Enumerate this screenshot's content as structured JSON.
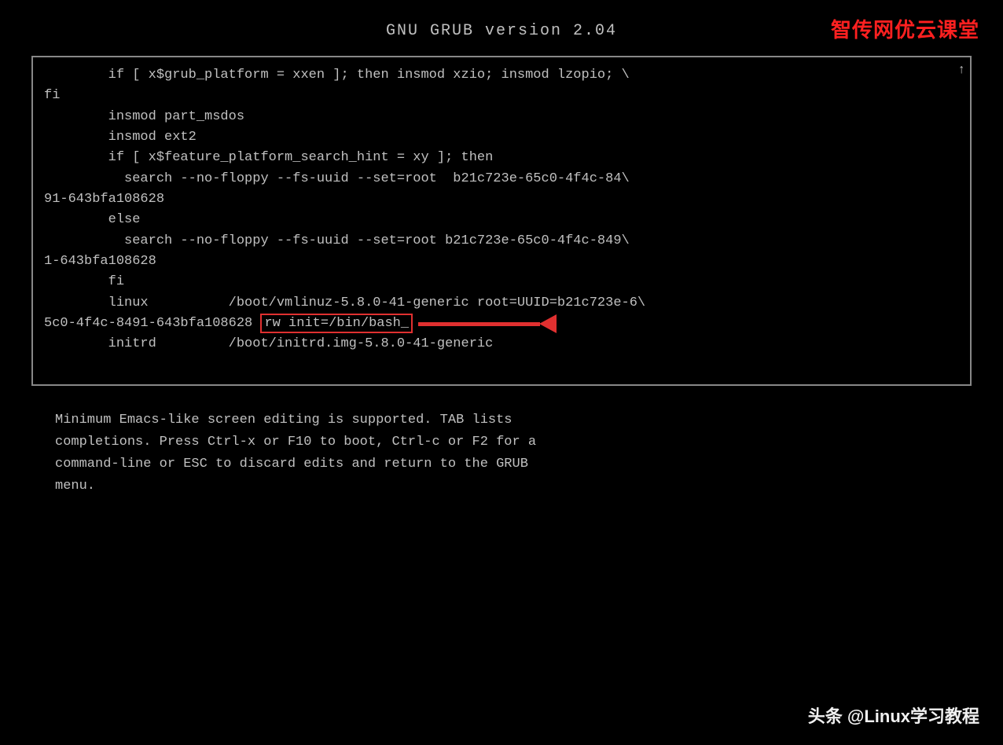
{
  "header": {
    "title": "GNU GRUB  version 2.04"
  },
  "watermark_top": "智传网优云课堂",
  "terminal": {
    "lines": [
      "        if [ x$grub_platform = xxen ]; then insmod xzio; insmod lzopio; \\",
      "fi",
      "        insmod part_msdos",
      "        insmod ext2",
      "        if [ x$feature_platform_search_hint = xy ]; then",
      "          search --no-floppy --fs-uuid --set=root  b21c723e-65c0-4f4c-84\\",
      "91-643bfa108628",
      "        else",
      "          search --no-floppy --fs-uuid --set=root b21c723e-65c0-4f4c-849\\",
      "1-643bfa108628",
      "        fi",
      "        linux          /boot/vmlinuz-5.8.0-41-generic root=UUID=b21c723e-6\\",
      "5c0-4f4c-8491-643bfa108628 rw init=/bin/bash_",
      "        initrd         /boot/initrd.img-5.8.0-41-generic"
    ],
    "highlighted_text": "rw init=/bin/bash_",
    "highlight_line_index": 12,
    "highlight_prefix": "5c0-4f4c-8491-643bfa108628 "
  },
  "description": {
    "text": "Minimum Emacs-like screen editing is supported. TAB lists\ncompletions. Press Ctrl-x or F10 to boot, Ctrl-c or F2 for a\ncommand-line or ESC to discard edits and return to the GRUB\nmenu."
  },
  "footer_watermark": "头条 @Linux学习教程"
}
